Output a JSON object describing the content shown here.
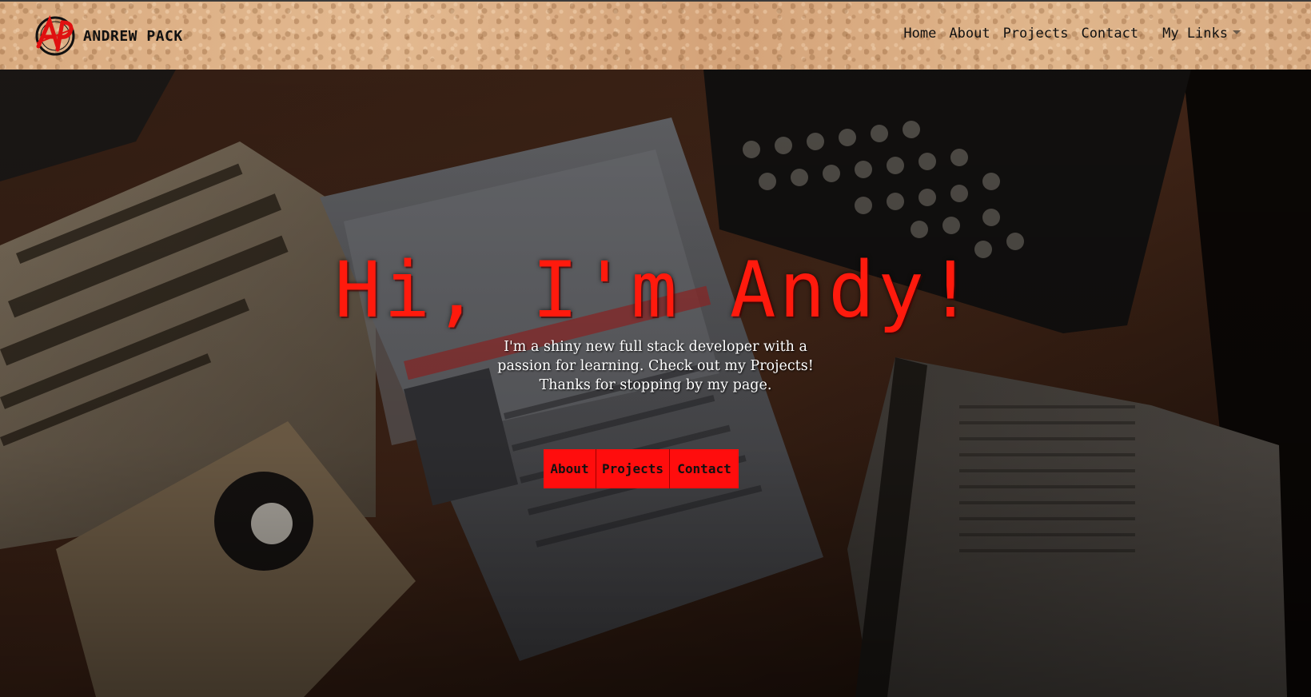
{
  "brand": {
    "name": "ANDREW PACK",
    "logo_icon": "ap-monogram-logo",
    "logo_letters": "AP",
    "accent": "#ff1a0d"
  },
  "nav": {
    "links": [
      "Home",
      "About",
      "Projects",
      "Contact"
    ],
    "dropdown_label": "My Links"
  },
  "hero": {
    "title": "Hi, I'm Andy!",
    "subtitle_lines": [
      "I'm a shiny new full stack developer with a",
      "passion for learning. Check out my Projects!",
      "Thanks for stopping by my page."
    ],
    "buttons": [
      "About",
      "Projects",
      "Contact"
    ],
    "button_color": "#ff0d0d",
    "background_image": "desk-with-newspapers-typewriter-book"
  }
}
